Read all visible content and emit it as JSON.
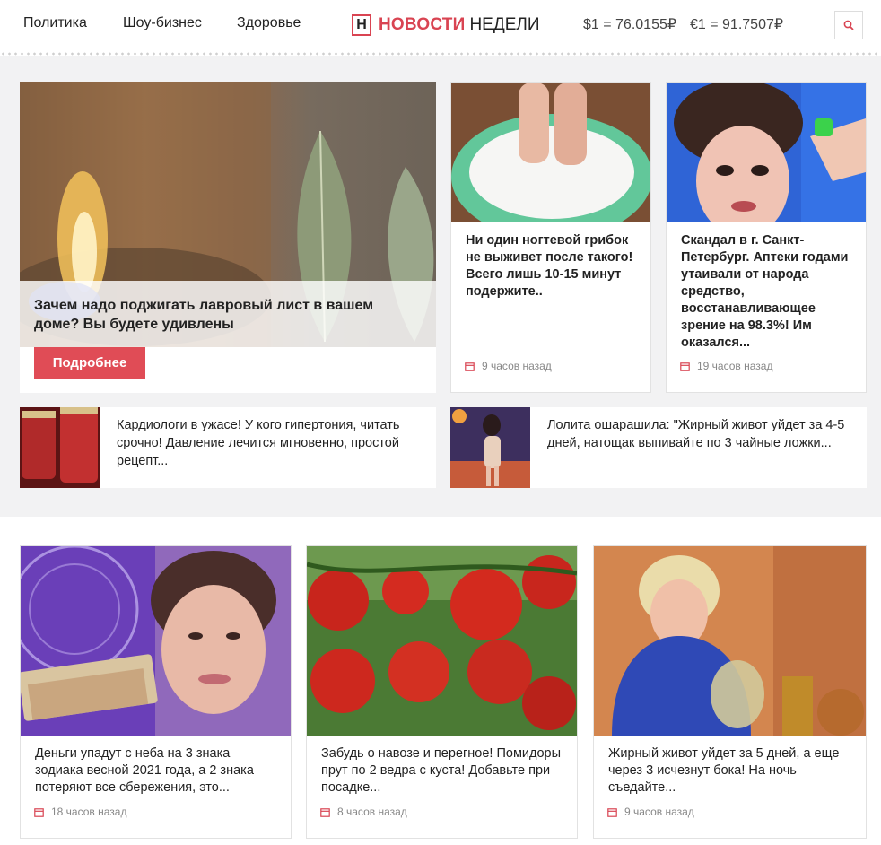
{
  "header": {
    "nav": [
      "Политика",
      "Шоу-бизнес",
      "Здоровье"
    ],
    "logo_letter": "Н",
    "logo_red": "НОВОСТИ",
    "logo_dark": "НЕДЕЛИ",
    "usd_rate": "$1 = 76.0155₽",
    "eur_rate": "€1 = 91.7507₽",
    "search_icon": "search-icon"
  },
  "featured": {
    "title": "Зачем надо поджигать лавровый лист в вашем доме? Вы будете удивлены",
    "button": "Подробнее"
  },
  "top_cards": [
    {
      "title": "Ни один ногтевой грибок не выживет после такого! Всего лишь 10-15 минут подержите..",
      "time": "9 часов назад"
    },
    {
      "title": "Скандал в г. Санкт-Петербург. Аптеки годами утаивали от народа средство, восстанавливающее зрение на 98.3%! Им оказался...",
      "time": "19 часов назад"
    }
  ],
  "strips": [
    {
      "title": "Кардиологи в ужасе! У кого гипертония, читать срочно! Давление лечится мгновенно, простой рецепт..."
    },
    {
      "title": "Лолита ошарашила: \"Жирный живот уйдет за 4-5 дней, натощак выпивайте по 3 чайные ложки..."
    }
  ],
  "bottom_cards": [
    {
      "title": "Деньги упадут с неба на 3 знака зодиака весной 2021 года, а 2 знака потеряют все сбережения, это...",
      "time": "18 часов назад"
    },
    {
      "title": "Забудь о навозе и перегное! Помидоры прут по 2 ведра с куста! Добавьте при посадке...",
      "time": "8 часов назад"
    },
    {
      "title": "Жирный живот уйдет за 5 дней, а еще через 3 исчезнут бока! На ночь съедайте...",
      "time": "9 часов назад"
    }
  ],
  "colors": {
    "accent": "#e04c56",
    "band": "#f2f2f3"
  }
}
